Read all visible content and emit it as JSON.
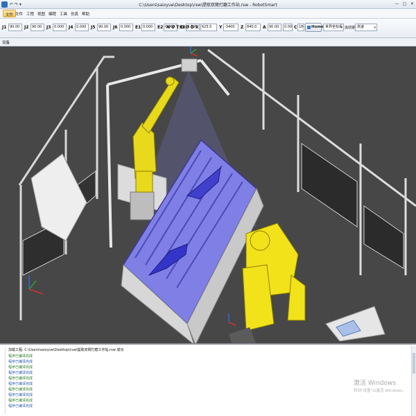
{
  "window": {
    "title": "C:\\Users\\saixyue\\Desktop\\rsw\\提取双臂打磨工作站.rsw - RobotSmart",
    "quick_access": "↶ ↷ ▾",
    "min": "—",
    "max": "□",
    "close": "✕"
  },
  "menu": {
    "items": [
      "文件",
      "文件",
      "工程",
      "视图",
      "编程",
      "工具",
      "仿真",
      "帮助"
    ]
  },
  "joints": {
    "items": [
      {
        "label": "J1",
        "value": "90.00"
      },
      {
        "label": "J2",
        "value": "90.00"
      },
      {
        "label": "J3",
        "value": "0.000"
      },
      {
        "label": "J4",
        "value": "0.000"
      },
      {
        "label": "J5",
        "value": "90.00"
      },
      {
        "label": "J6",
        "value": "0.000"
      },
      {
        "label": "E1",
        "value": "0.000"
      },
      {
        "label": "E2",
        "value": "0.000"
      },
      {
        "label": "E3",
        "value": "0.000"
      }
    ],
    "xyz_label": "N U T O O O X",
    "y_label": "Y",
    "y_value": "-3400",
    "z_label": "Z",
    "z_value": "840.0",
    "x_value": "625.5",
    "a_label": "A",
    "a_value": "90.00",
    "b_label": "B",
    "b_value": "0.000",
    "c_label": "C",
    "c_value": "180.0",
    "home_label": "Home",
    "coord_select": "世界坐标系",
    "speed_label": "运动速度",
    "speed_select": "高速"
  },
  "toolbar2": {
    "label": "设备"
  },
  "output": {
    "lines": [
      {
        "text": "加载工程: C:\\Users\\saixyue\\Desktop\\rsw\\提取双臂打磨工作站.rsw 成功",
        "cls": "l0"
      },
      {
        "text": "程序已编译完成",
        "cls": "lg"
      },
      {
        "text": "程序已编译完成",
        "cls": "lb"
      },
      {
        "text": "程序已编译完成",
        "cls": "lg"
      },
      {
        "text": "程序已编译完成",
        "cls": "lb"
      },
      {
        "text": "程序已编译完成",
        "cls": "lg"
      },
      {
        "text": "程序已编译完成",
        "cls": "lb"
      },
      {
        "text": "程序已编译完成",
        "cls": "lg"
      },
      {
        "text": "程序已编译完成",
        "cls": "lb"
      },
      {
        "text": "程序已编译完成",
        "cls": "lg"
      },
      {
        "text": "程序已编译完成",
        "cls": "lb"
      }
    ],
    "activate_title": "激活 Windows",
    "activate_sub": "转到\"设置\"以激活 Windows。"
  }
}
